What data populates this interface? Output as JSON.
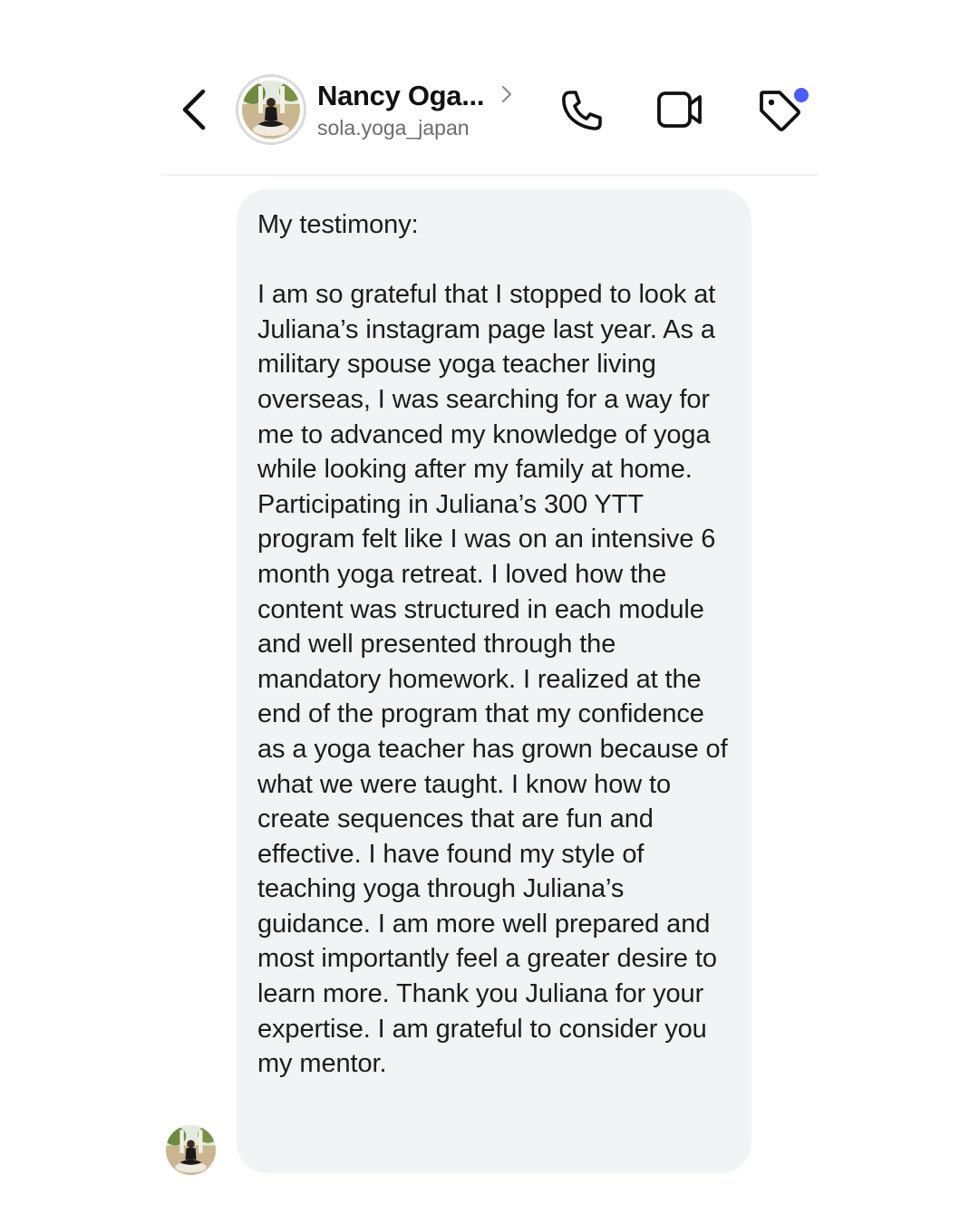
{
  "header": {
    "back_icon": "chevron-left-icon",
    "contact_name": "Nancy Oga...",
    "contact_handle": "sola.yoga_japan",
    "name_chevron_icon": "chevron-right-icon",
    "actions": {
      "call_icon": "phone-icon",
      "video_icon": "video-camera-icon",
      "tag_icon": "tag-icon"
    },
    "notification_dot_color": "#4c5cff"
  },
  "message": {
    "text": "My testimony:\n\nI am so grateful that I stopped to look at Juliana’s instagram page last year. As a military spouse yoga teacher living overseas, I was searching for a way for me to advanced my knowledge of yoga while looking after my family at home. Participating in Juliana’s 300 YTT program felt like I was on an intensive 6 month yoga retreat. I loved how the content was structured in each module and well presented through the mandatory homework. I realized at the end of the program that my confidence as a yoga teacher has grown because of what we were taught. I know how to create sequences that are fun and effective. I have found my style of teaching yoga through Juliana’s guidance. I am more well prepared and most importantly feel a greater desire to learn more. Thank you Juliana for your expertise. I am grateful to consider you my mentor.",
    "bubble_color": "#f2f3f5"
  }
}
